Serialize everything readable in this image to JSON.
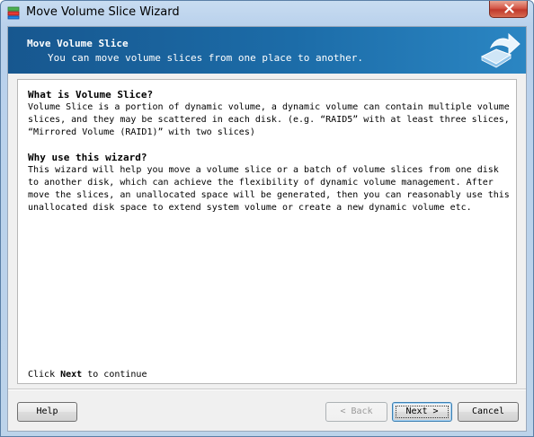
{
  "window": {
    "title": "Move Volume Slice Wizard"
  },
  "header": {
    "title": "Move Volume Slice",
    "subtitle": "You can move volume slices from one place to another.",
    "icon": "arrow-move-icon"
  },
  "content": {
    "section1": {
      "heading": "What is Volume Slice?",
      "body": "Volume Slice is a portion of dynamic volume, a dynamic volume can contain multiple volume\nslices, and they may be scattered in each disk. (e.g. “RAID5” with at least three slices,\n“Mirrored Volume (RAID1)” with two slices)"
    },
    "section2": {
      "heading": "Why use this wizard?",
      "body": "This wizard will help you move a volume slice or a batch of volume slices from one disk\nto another disk, which can achieve the flexibility of dynamic volume management. After\nmove the slices, an unallocated space will be generated, then you can reasonably use this\nunallocated disk space to extend system volume or create a new dynamic volume etc."
    },
    "continue_prefix": "Click ",
    "continue_bold": "Next",
    "continue_suffix": " to continue"
  },
  "buttons": {
    "help": "Help",
    "back": "< Back",
    "next": "Next >",
    "cancel": "Cancel"
  },
  "colors": {
    "banner": "#1c6ca8",
    "close": "#c0392b"
  }
}
